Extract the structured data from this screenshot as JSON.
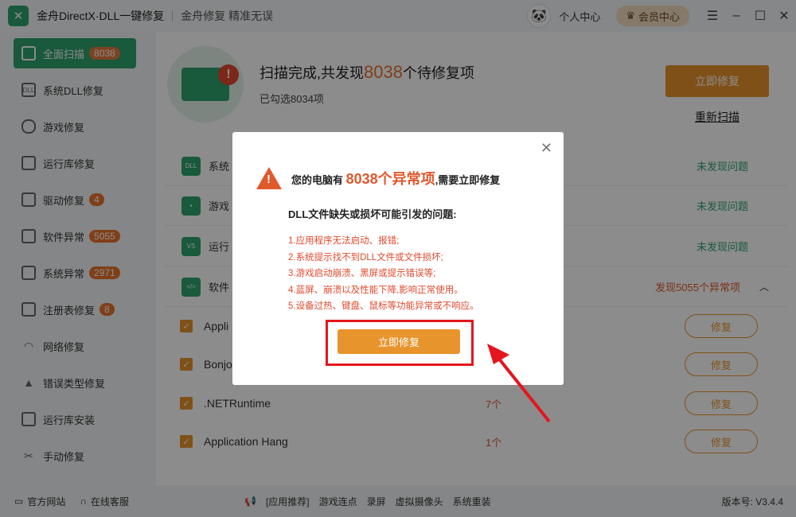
{
  "app": {
    "title": "金舟DirectX·DLL一键修复",
    "subtitle": "金舟修复 精准无误",
    "personal": "个人中心",
    "vip": "会员中心"
  },
  "sidebar": {
    "items": [
      {
        "label": "全面扫描",
        "badge": "8038",
        "active": true
      },
      {
        "label": "系统DLL修复",
        "badge": ""
      },
      {
        "label": "游戏修复",
        "badge": ""
      },
      {
        "label": "运行库修复",
        "badge": ""
      },
      {
        "label": "驱动修复",
        "badge": "4"
      },
      {
        "label": "软件异常",
        "badge": "5055"
      },
      {
        "label": "系统异常",
        "badge": "2971"
      },
      {
        "label": "注册表修复",
        "badge": "8"
      },
      {
        "label": "网络修复",
        "badge": ""
      },
      {
        "label": "错误类型修复",
        "badge": ""
      },
      {
        "label": "运行库安装",
        "badge": ""
      },
      {
        "label": "手动修复",
        "badge": ""
      }
    ]
  },
  "scan": {
    "title_prefix": "扫描完成,共发现",
    "count": "8038",
    "title_suffix": "个待修复项",
    "selected": "已勾选8034项",
    "fix_button": "立即修复",
    "rescan": "重新扫描"
  },
  "categories": [
    {
      "name": "系统",
      "icon": "DLL",
      "status": "未发现问题"
    },
    {
      "name": "游戏",
      "icon": "pad",
      "status": "未发现问题"
    },
    {
      "name": "运行",
      "icon": "VS",
      "status": "未发现问题"
    },
    {
      "name": "软件",
      "icon": "</>",
      "status": "发现5055个异常项"
    }
  ],
  "items": [
    {
      "name": "Appli",
      "count": "",
      "button": "修复"
    },
    {
      "name": "Bonjo",
      "count": "",
      "button": "修复"
    },
    {
      "name": ".NETRuntime",
      "count": "7个",
      "button": "修复"
    },
    {
      "name": "Application Hang",
      "count": "1个",
      "button": "修复"
    }
  ],
  "footer": {
    "site": "官方网站",
    "service": "在线客服",
    "recommend": "[应用推荐]",
    "links": [
      "游戏连点",
      "录屏",
      "虚拟摄像头",
      "系统重装"
    ],
    "version": "版本号: V3.4.4"
  },
  "modal": {
    "warn_prefix": "您的电脑有",
    "warn_count": "8038个异常项",
    "warn_suffix": ",需要立即修复",
    "subtitle": "DLL文件缺失或损坏可能引发的问题:",
    "problems": [
      "1.应用程序无法启动、报错;",
      "2.系统提示找不到DLL文件或文件损坏;",
      "3.游戏启动崩溃、黑屏或提示错误等;",
      "4.蓝屏、崩溃以及性能下降,影响正常使用。",
      "5.设备过热、键盘、鼠标等功能异常或不响应。"
    ],
    "button": "立即修复"
  },
  "colors": {
    "brand": "#2fa36e",
    "accent": "#e8942c",
    "warn": "#e0592d"
  }
}
